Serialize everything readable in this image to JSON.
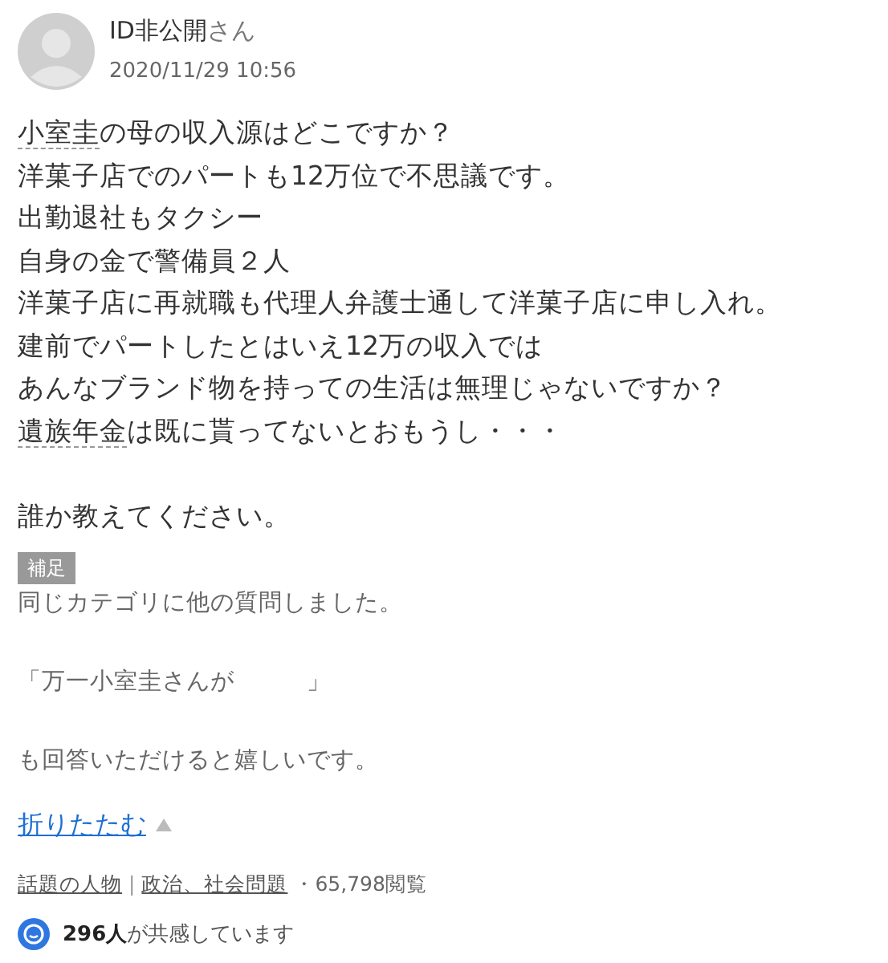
{
  "author": {
    "name": "ID非公開",
    "suffix": "さん",
    "date": "2020/11/29 10:56"
  },
  "body": [
    [
      [
        {
          "text": "小室圭",
          "keyword": true
        },
        {
          "text": "の母の収入源はどこですか？",
          "keyword": false
        }
      ],
      [
        {
          "text": "洋菓子店でのパートも12万位で不思議です。",
          "keyword": false
        }
      ],
      [
        {
          "text": "出勤退社もタクシー",
          "keyword": false
        }
      ],
      [
        {
          "text": "自身の金で警備員２人",
          "keyword": false
        }
      ],
      [
        {
          "text": "洋菓子店に再就職も代理人弁護士通して洋菓子店に申し入れ。",
          "keyword": false
        }
      ],
      [
        {
          "text": "建前でパートしたとはいえ12万の収入では",
          "keyword": false
        }
      ],
      [
        {
          "text": "あんなブランド物を持っての生活は無理じゃないですか？",
          "keyword": false
        }
      ],
      [
        {
          "text": "遺族年金",
          "keyword": true
        },
        {
          "text": "は既に貰ってないとおもうし・・・",
          "keyword": false
        }
      ]
    ],
    [
      [
        {
          "text": "誰か教えてください。",
          "keyword": false
        }
      ]
    ]
  ],
  "supplement": {
    "label": "補足",
    "paragraphs": [
      "同じカテゴリに他の質問しました。",
      "「万一小室圭さんが　　　」",
      "も回答いただけると嬉しいです。"
    ]
  },
  "collapse": {
    "label": "折りたたむ",
    "expanded": true
  },
  "meta": {
    "categories": [
      "話題の人物",
      "政治、社会問題"
    ],
    "separator": "|",
    "views": "・65,798閲覧"
  },
  "empathy": {
    "count": "296人",
    "text": "が共感しています"
  }
}
